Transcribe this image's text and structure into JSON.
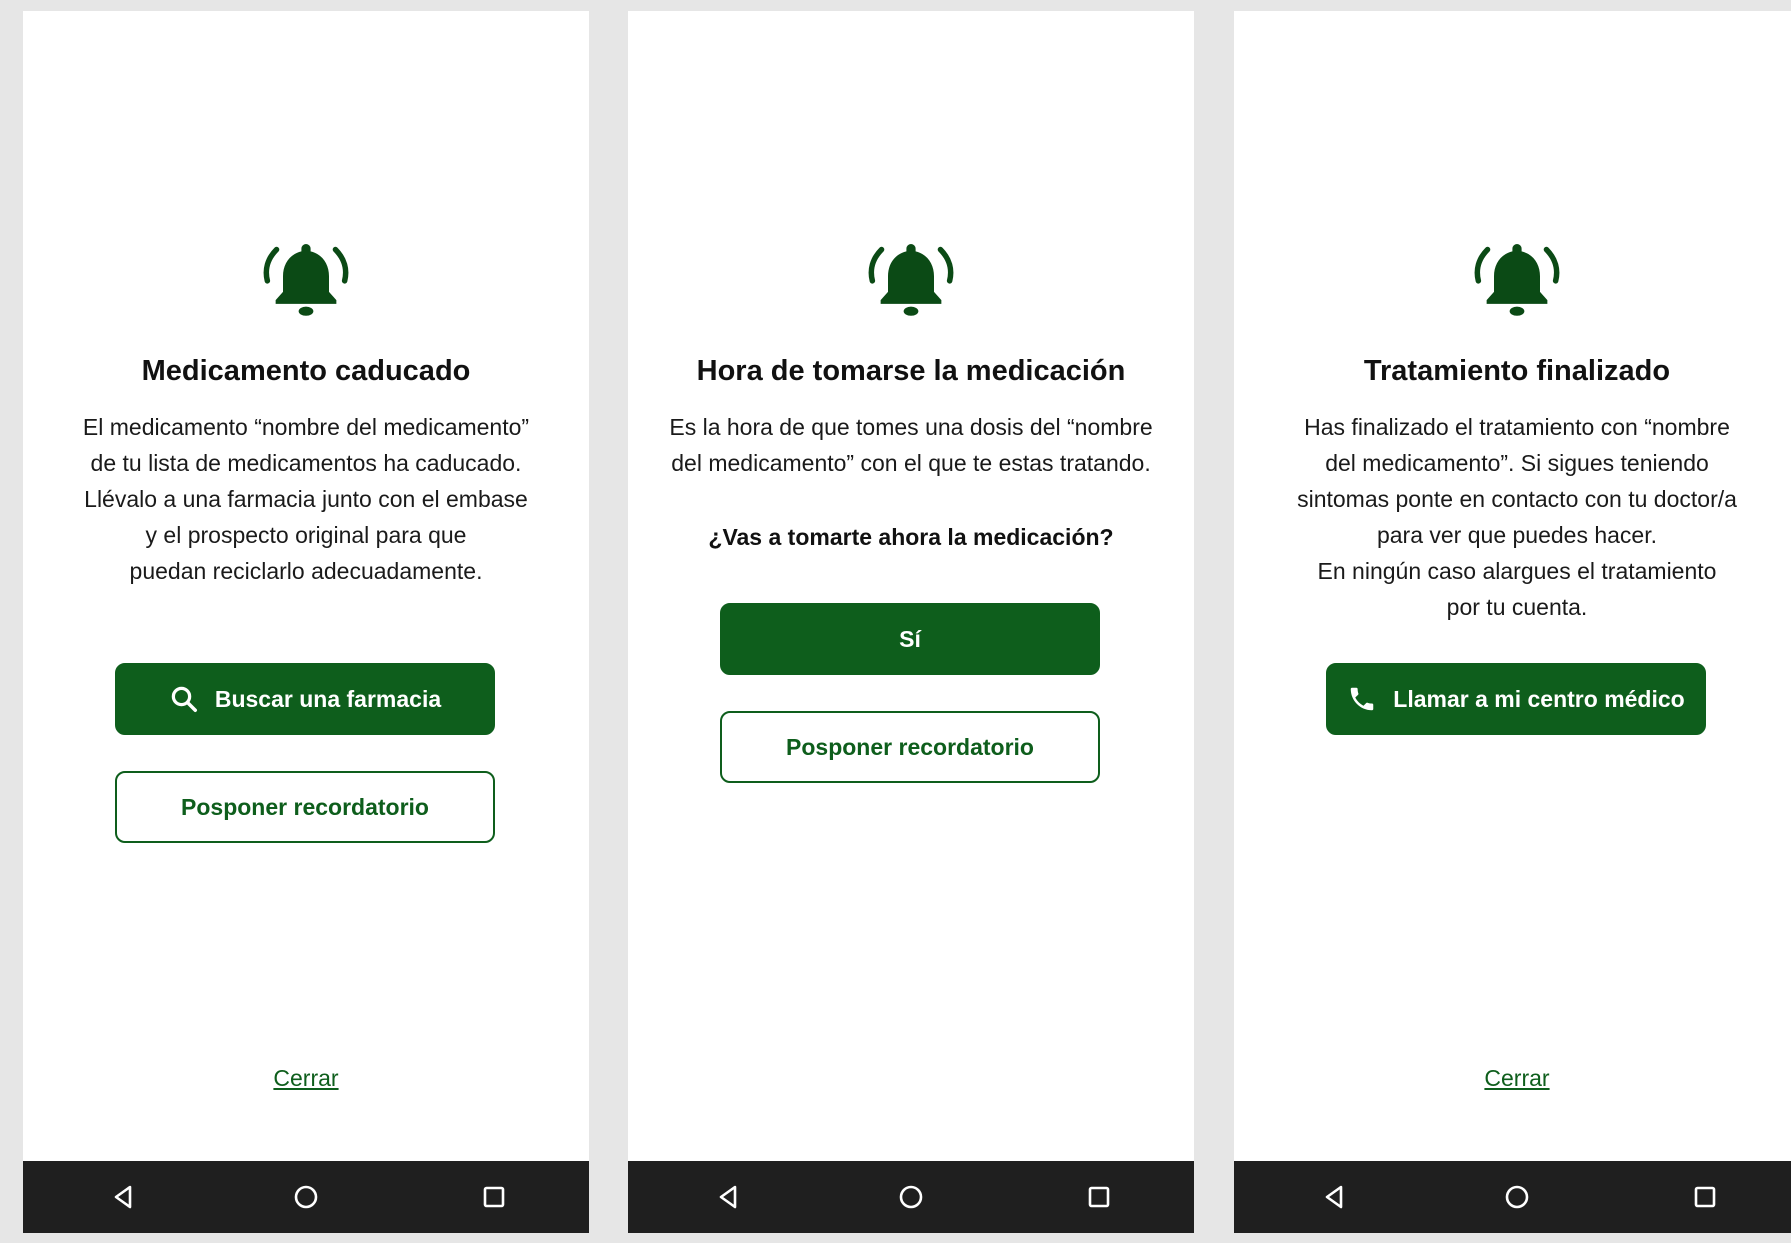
{
  "colors": {
    "brand_green": "#0e5e1c",
    "bell_green": "#0b4a15",
    "navbar_bg": "#1f1f1f",
    "page_bg": "#e6e6e6"
  },
  "screens": [
    {
      "icon": "bell-ringing-icon",
      "title": "Medicamento caducado",
      "body_lines": [
        "El medicamento “nombre del medicamento”",
        "de tu lista de medicamentos ha caducado.",
        "Llévalo a una farmacia junto con el embase",
        "y el prospecto original para que",
        "puedan reciclarlo adecuadamente."
      ],
      "primary_button": {
        "label": "Buscar una farmacia",
        "icon": "search-icon"
      },
      "secondary_button": {
        "label": "Posponer recordatorio"
      },
      "close_link": "Cerrar"
    },
    {
      "icon": "bell-ringing-icon",
      "title": "Hora de tomarse la medicación",
      "body_lines": [
        "Es la hora de que tomes una dosis del “nombre",
        "del medicamento” con el que te estas tratando."
      ],
      "question": "¿Vas a tomarte ahora la medicación?",
      "primary_button": {
        "label": "Sí"
      },
      "secondary_button": {
        "label": "Posponer recordatorio"
      }
    },
    {
      "icon": "bell-ringing-icon",
      "title": "Tratamiento finalizado",
      "body_lines": [
        "Has finalizado el tratamiento con “nombre",
        "del medicamento”. Si sigues teniendo",
        "sintomas ponte en contacto con tu doctor/a",
        "para ver que puedes hacer.",
        "En ningún caso alargues el tratamiento",
        "por tu cuenta."
      ],
      "primary_button": {
        "label": "Llamar a mi centro médico",
        "icon": "phone-icon"
      },
      "close_link": "Cerrar"
    }
  ],
  "navbar": {
    "icons": [
      "back-triangle-icon",
      "home-circle-icon",
      "recents-square-icon"
    ]
  }
}
